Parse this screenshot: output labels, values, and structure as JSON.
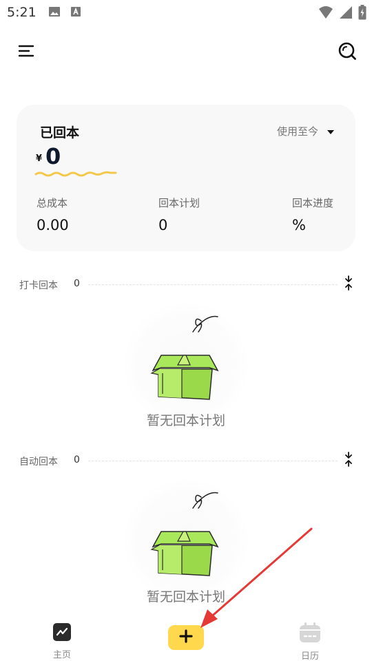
{
  "status_bar": {
    "time": "5:21",
    "icons": [
      "image-icon",
      "font-icon",
      "wifi-icon",
      "signal-icon",
      "battery-icon"
    ]
  },
  "header": {
    "menu_icon": "menu-icon",
    "search_icon": "search-icon"
  },
  "summary": {
    "title": "已回本",
    "period": "使用至今",
    "currency": "¥",
    "amount": "0",
    "accent_color": "#f2c94c",
    "stats": [
      {
        "label": "总成本",
        "value": "0.00"
      },
      {
        "label": "回本计划",
        "value": "0"
      },
      {
        "label": "回本进度",
        "value": "%"
      }
    ]
  },
  "sections": [
    {
      "title": "打卡回本",
      "count": "0",
      "empty_text": "暂无回本计划"
    },
    {
      "title": "自动回本",
      "count": "0",
      "empty_text": "暂无回本计划"
    }
  ],
  "bottom_nav": {
    "home_label": "主页",
    "add_icon": "plus-icon",
    "calendar_label": "日历",
    "add_color": "#ffd84d"
  },
  "annotation": {
    "color": "#e53935"
  }
}
